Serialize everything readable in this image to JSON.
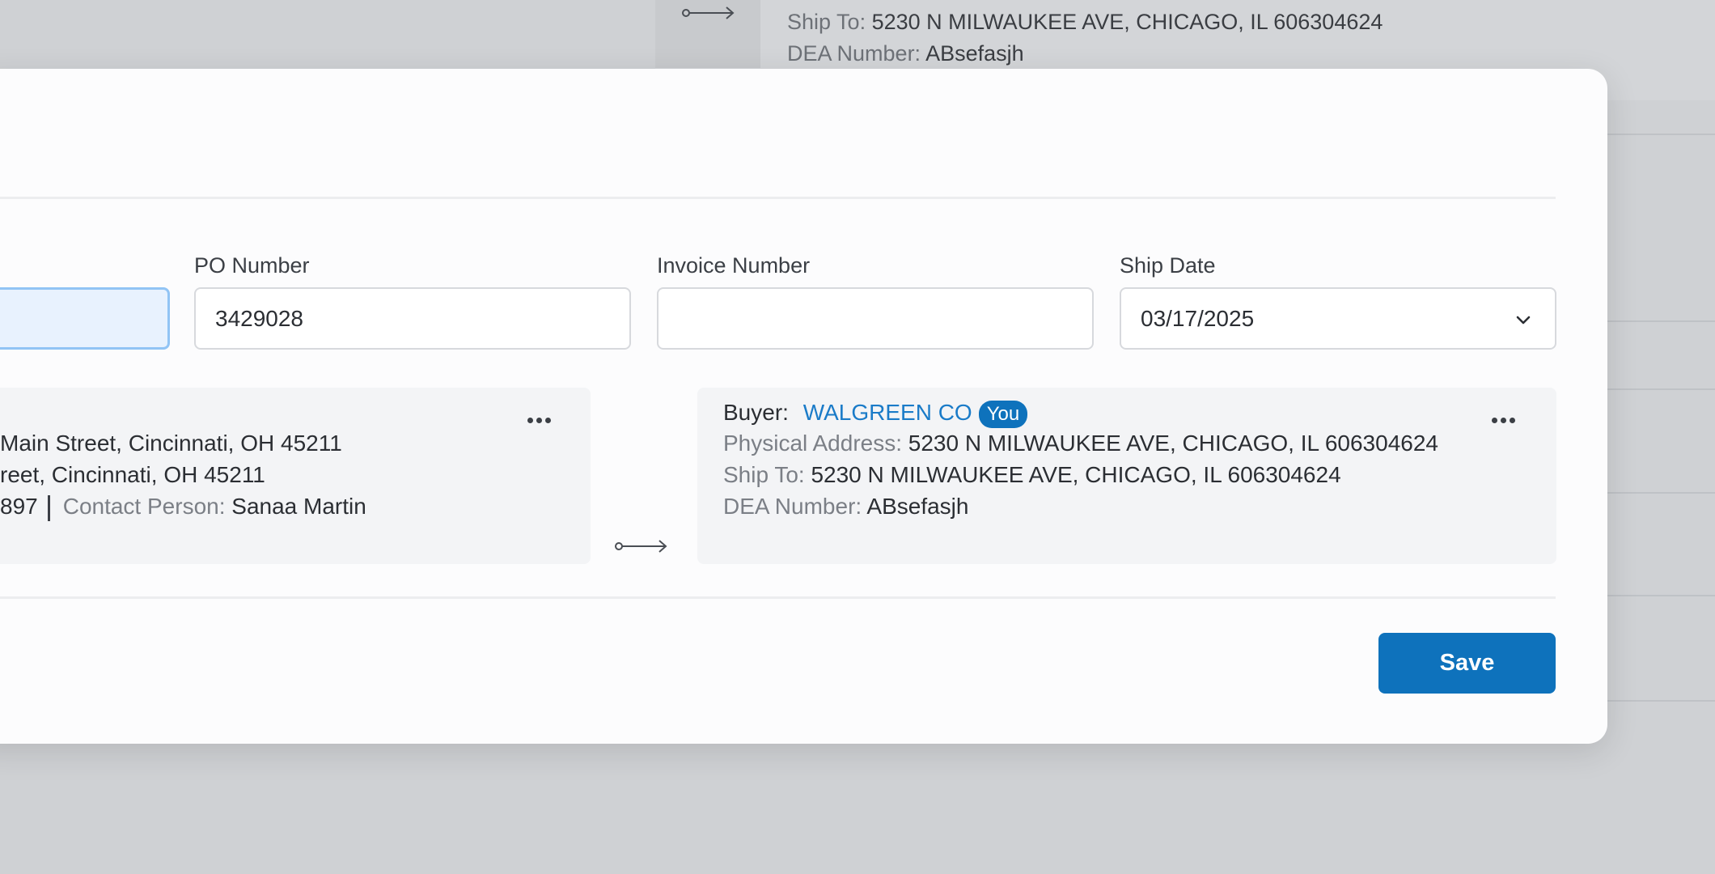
{
  "background": {
    "ship_to_label": "Ship To:",
    "ship_to_value": "5230 N MILWAUKEE AVE, CHICAGO, IL 606304624",
    "dea_label": "DEA Number:",
    "dea_value": "ABsefasjh"
  },
  "form": {
    "po_number": {
      "label": "PO Number",
      "value": "3429028"
    },
    "invoice_number": {
      "label": "Invoice Number",
      "value": ""
    },
    "ship_date": {
      "label": "Ship Date",
      "value": "03/17/2025"
    }
  },
  "seller": {
    "address_line1": "Main Street, Cincinnati, OH 45211",
    "address_line2": "reet, Cincinnati, OH 45211",
    "phone_fragment": "897",
    "contact_label": "Contact Person:",
    "contact_value": "Sanaa Martin"
  },
  "buyer": {
    "buyer_label": "Buyer:",
    "buyer_name": "WALGREEN CO",
    "badge": "You",
    "physical_label": "Physical Address:",
    "physical_value": "5230 N MILWAUKEE AVE, CHICAGO, IL 606304624",
    "ship_to_label": "Ship To:",
    "ship_to_value": "5230 N MILWAUKEE AVE, CHICAGO, IL 606304624",
    "dea_label": "DEA Number:",
    "dea_value": "ABsefasjh"
  },
  "actions": {
    "save_label": "Save"
  },
  "colors": {
    "accent": "#0e72bc",
    "link": "#1a7bc8",
    "panel": "#f3f4f6"
  },
  "icons": [
    "arrow-right-icon",
    "chevron-down-icon",
    "more-horizontal-icon"
  ]
}
